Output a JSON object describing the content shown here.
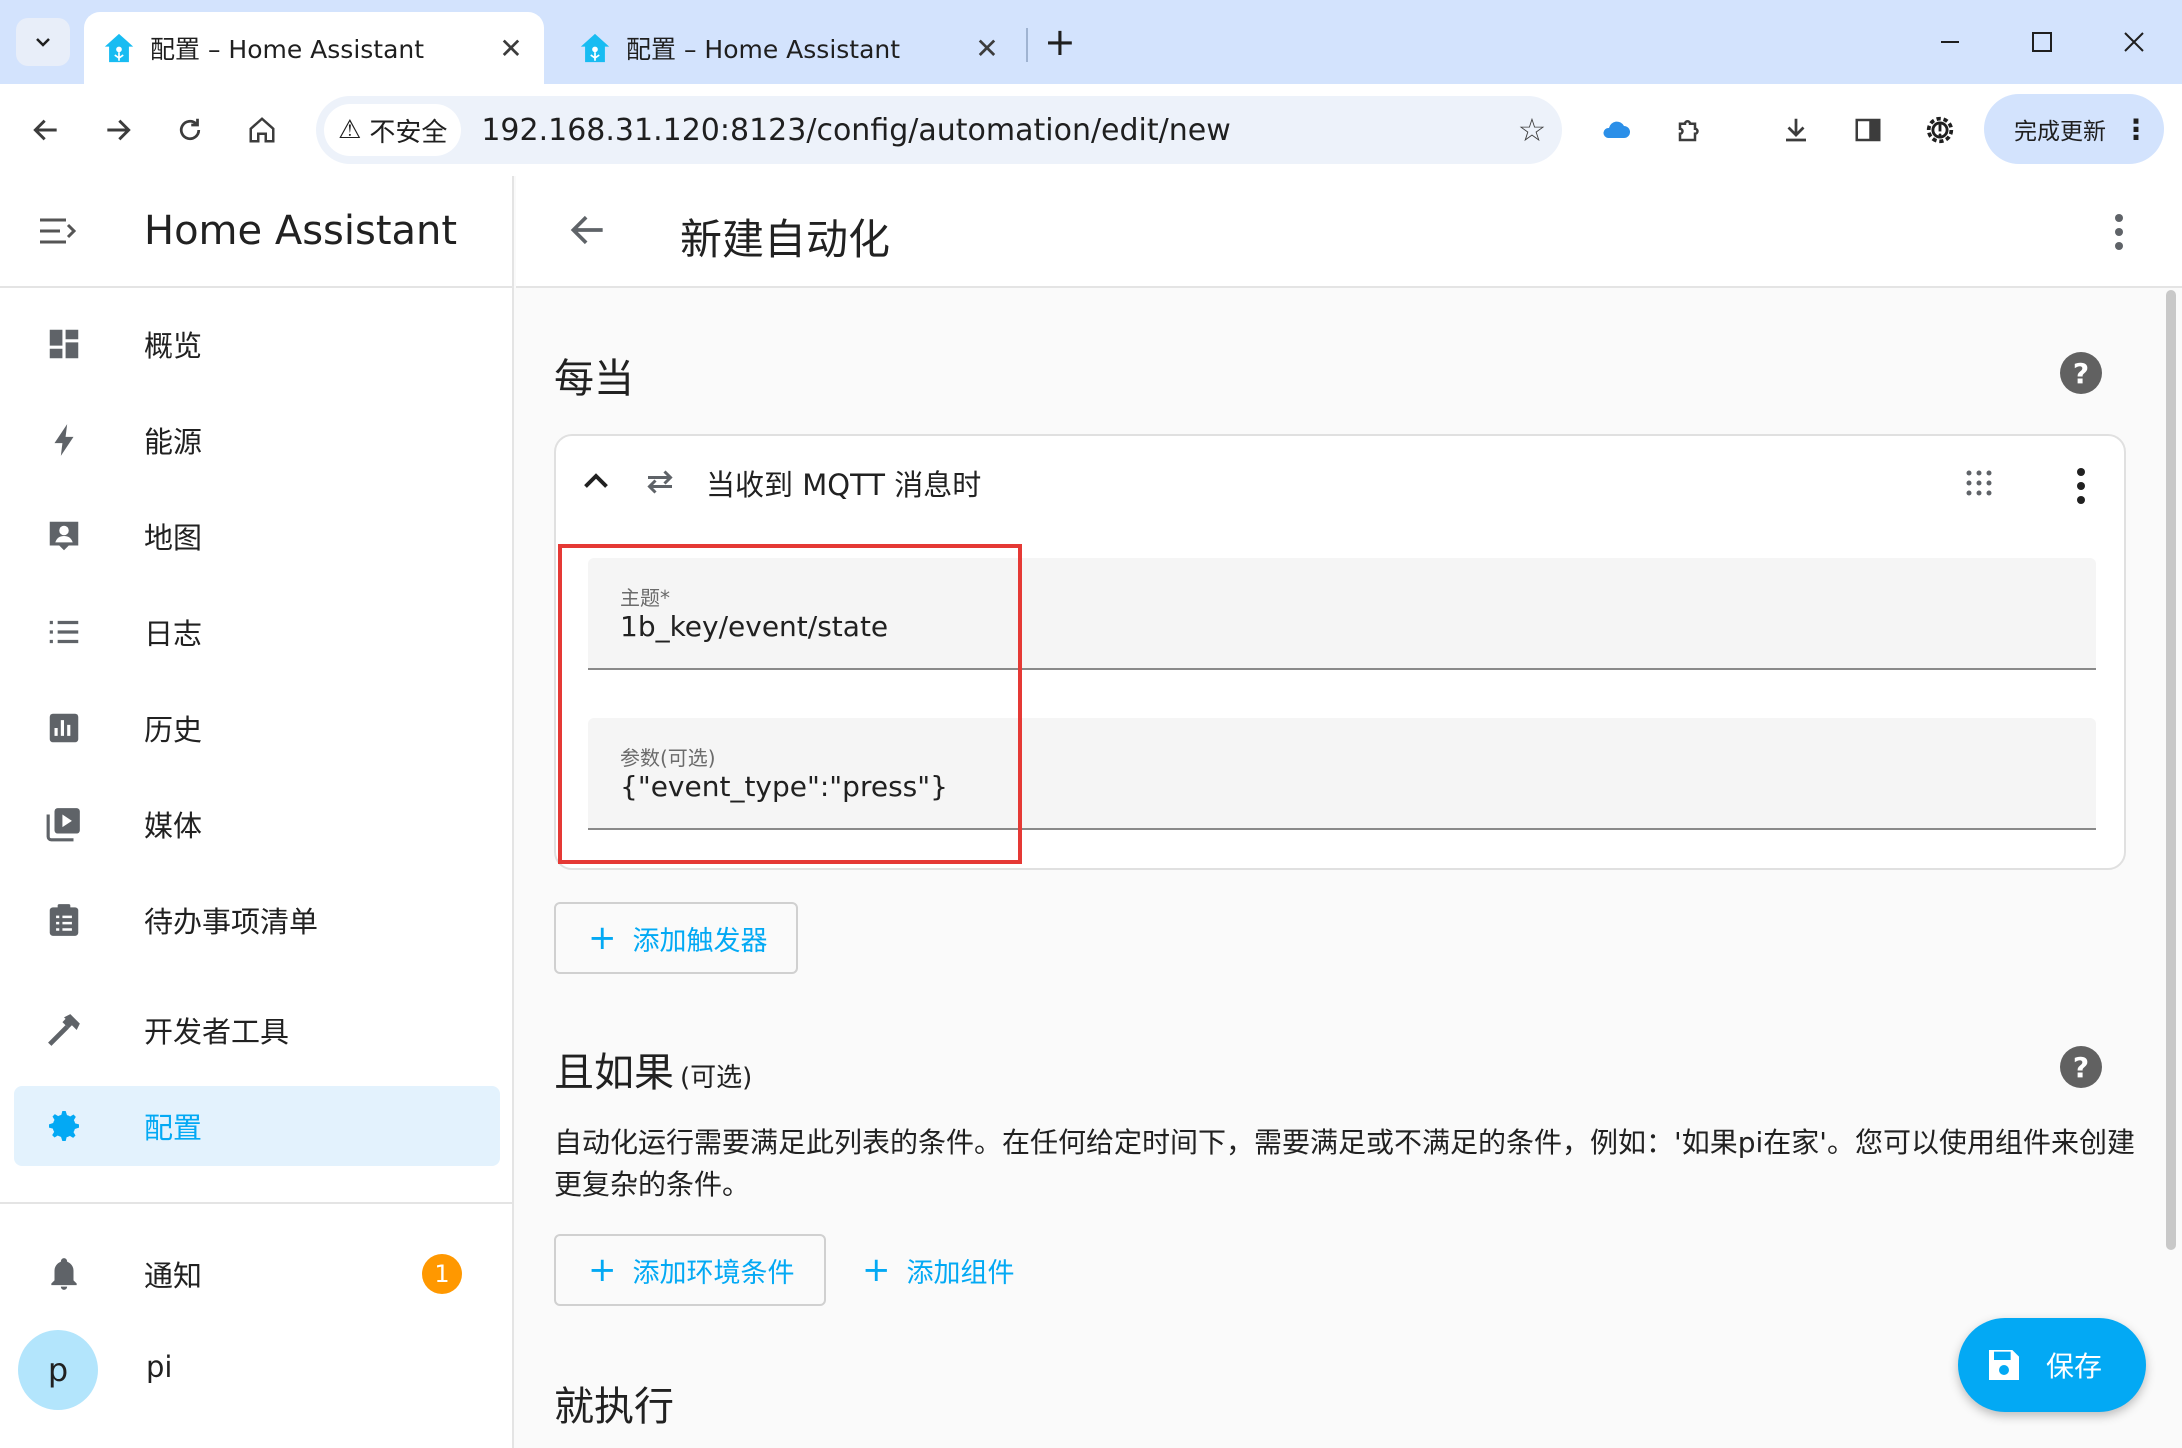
{
  "browser": {
    "tabs": [
      {
        "title": "配置 – Home Assistant",
        "active": true
      },
      {
        "title": "配置 – Home Assistant",
        "active": false
      }
    ],
    "security_label": "不安全",
    "url": "192.168.31.120:8123/config/automation/edit/new",
    "update_button": "完成更新"
  },
  "sidebar": {
    "title": "Home Assistant",
    "items": [
      {
        "label": "概览",
        "icon": "dashboard-icon"
      },
      {
        "label": "能源",
        "icon": "lightning-icon"
      },
      {
        "label": "地图",
        "icon": "map-person-icon"
      },
      {
        "label": "日志",
        "icon": "list-icon"
      },
      {
        "label": "历史",
        "icon": "chart-icon"
      },
      {
        "label": "媒体",
        "icon": "media-icon"
      },
      {
        "label": "待办事项清单",
        "icon": "clipboard-list-icon"
      },
      {
        "label": "开发者工具",
        "icon": "hammer-icon"
      },
      {
        "label": "配置",
        "icon": "gear-icon",
        "selected": true
      }
    ],
    "notifications": {
      "label": "通知",
      "count": "1"
    },
    "user": {
      "initial": "p",
      "name": "pi"
    }
  },
  "main": {
    "title": "新建自动化",
    "triggers": {
      "heading": "每当",
      "card": {
        "title": "当收到 MQTT 消息时",
        "topic_label": "主题*",
        "topic_value": "1b_key/event/state",
        "payload_label": "参数(可选)",
        "payload_value": "{\"event_type\":\"press\"}"
      },
      "add_button": "添加触发器"
    },
    "conditions": {
      "heading": "且如果",
      "optional": "(可选)",
      "description": "自动化运行需要满足此列表的条件。在任何给定时间下，需要满足或不满足的条件，例如：'如果pi在家'。您可以使用组件来创建更复杂的条件。",
      "add_condition": "添加环境条件",
      "add_block": "添加组件"
    },
    "actions": {
      "heading": "就执行"
    },
    "save_button": "保存"
  },
  "colors": {
    "accent": "#03a9f4",
    "badge": "#ff9800",
    "highlight": "#e53935"
  }
}
